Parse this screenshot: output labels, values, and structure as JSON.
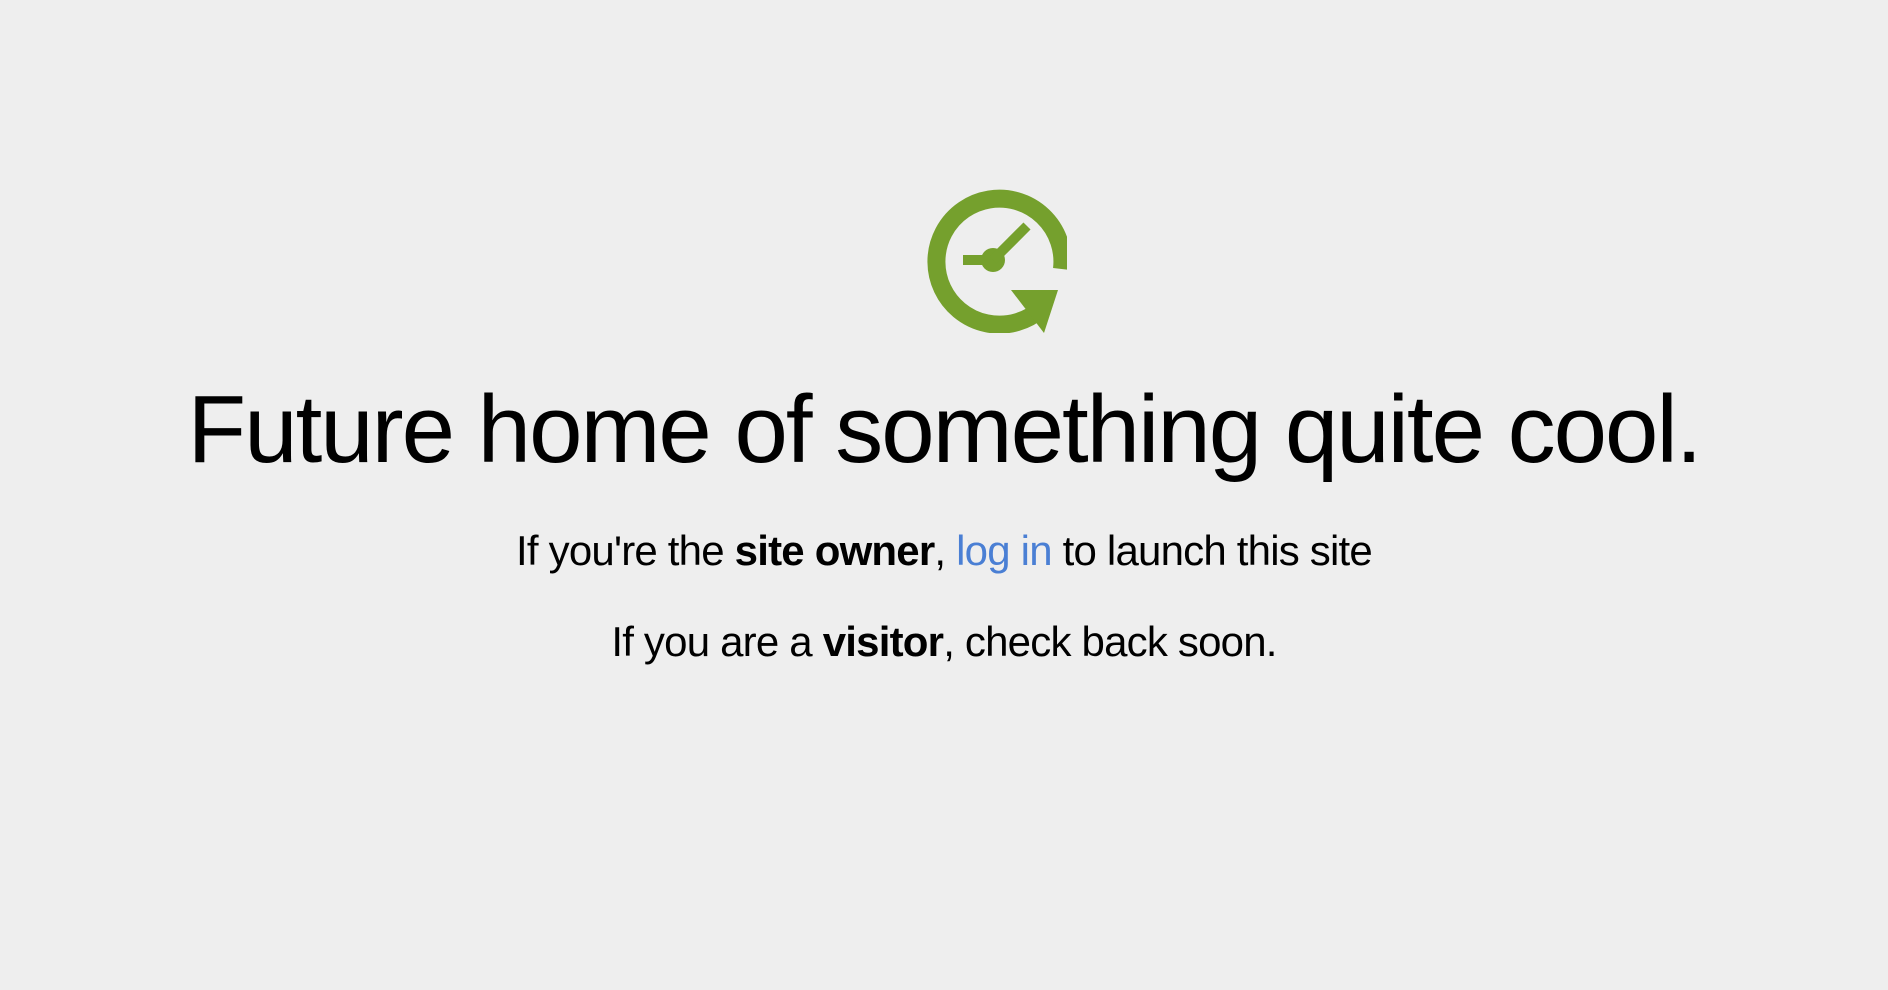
{
  "logo": {
    "icon": "clock-refresh-icon",
    "color": "#75a02d"
  },
  "headline": "Future home of something quite cool.",
  "owner_line": {
    "prefix": "If you're the ",
    "emphasis": "site owner",
    "comma": ", ",
    "link_text": "log in",
    "suffix": " to launch this site"
  },
  "visitor_line": {
    "prefix": "If you are a ",
    "emphasis": "visitor",
    "suffix": ", check back soon."
  },
  "colors": {
    "background": "#eeeeee",
    "text": "#000000",
    "link": "#4a7fd4"
  }
}
